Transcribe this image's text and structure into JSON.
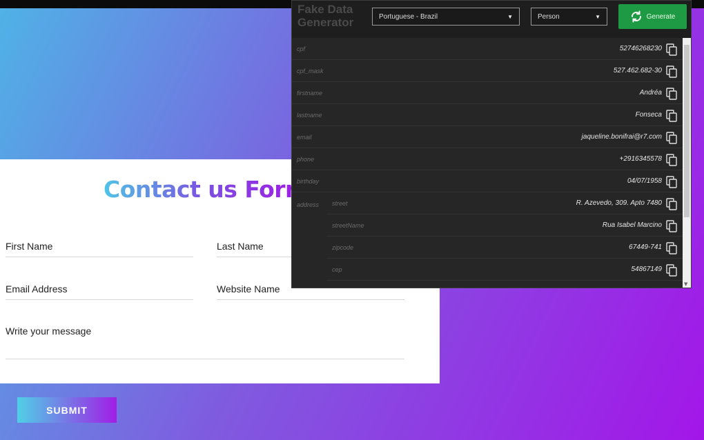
{
  "form": {
    "title": "Contact us Form",
    "fields": {
      "first_name": "First Name",
      "last_name": "Last Name",
      "email": "Email Address",
      "website": "Website Name",
      "message": "Write your message"
    },
    "submit_label": "SUBMIT"
  },
  "generator": {
    "title": "Fake Data Generator",
    "locale": "Portuguese - Brazil",
    "type": "Person",
    "generate_label": "Generate",
    "rows": [
      {
        "key": "cpf",
        "value": "52746268230"
      },
      {
        "key": "cpf_mask",
        "value": "527.462.682-30"
      },
      {
        "key": "firstname",
        "value": "Andréa"
      },
      {
        "key": "lastname",
        "value": "Fonseca"
      },
      {
        "key": "email",
        "value": "jaqueline.bonifrai@r7.com"
      },
      {
        "key": "phone",
        "value": "+2916345578"
      },
      {
        "key": "birthday",
        "value": "04/07/1958"
      }
    ],
    "address_label": "address",
    "address": [
      {
        "key": "street",
        "value": "R. Azevedo, 309. Apto 7480"
      },
      {
        "key": "streetName",
        "value": "Rua Isabel Marcino"
      },
      {
        "key": "zipcode",
        "value": "67449-741"
      },
      {
        "key": "cep",
        "value": "54867149"
      }
    ]
  },
  "colors": {
    "accent_green": "#1f9a44",
    "gradient_start": "#4fb3e6",
    "gradient_end": "#a316e8"
  }
}
